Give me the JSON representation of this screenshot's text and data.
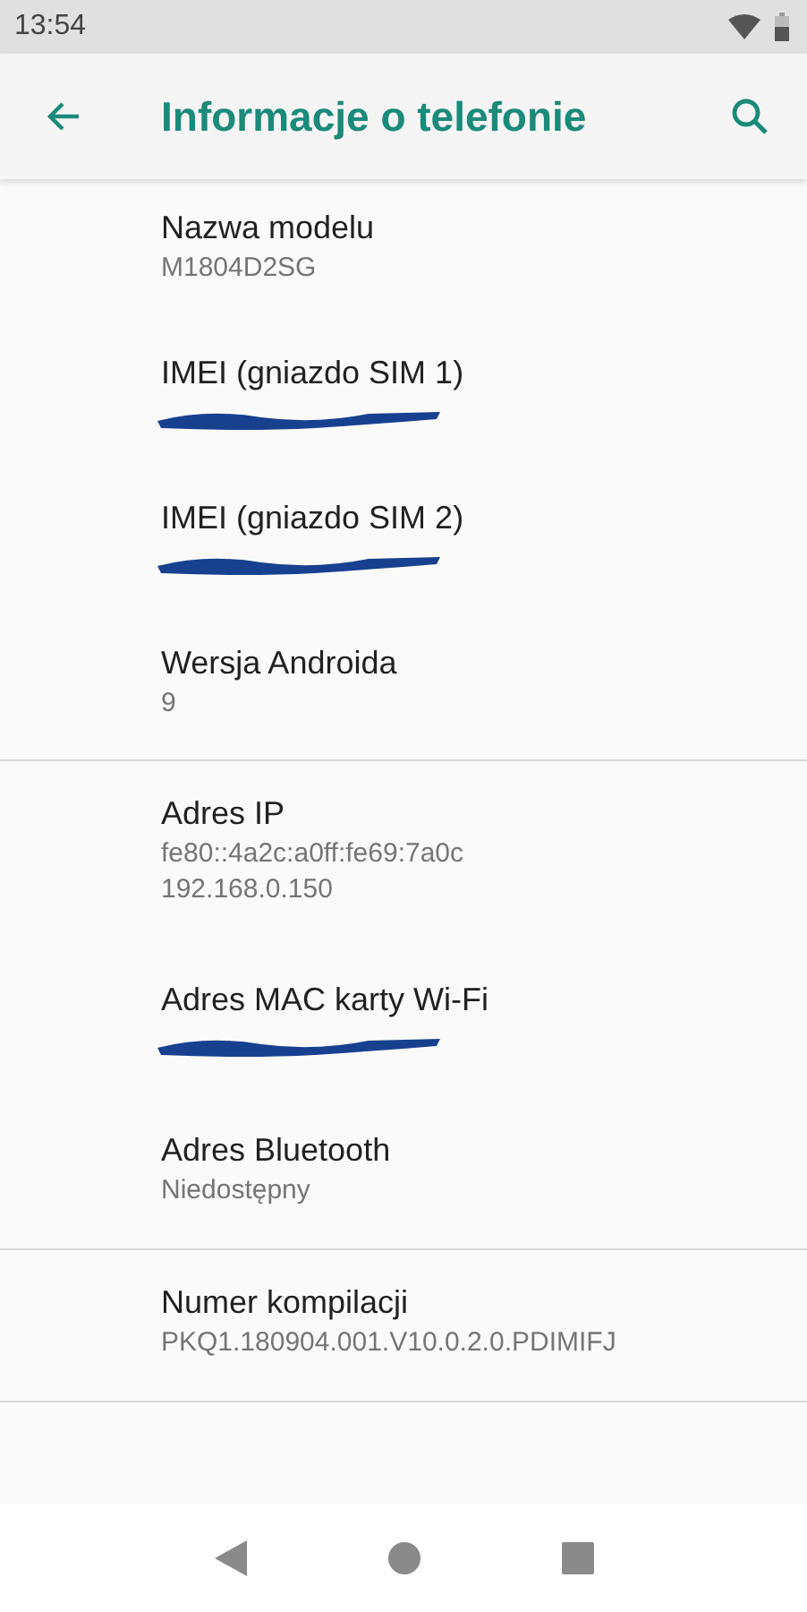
{
  "status_bar": {
    "time": "13:54"
  },
  "toolbar": {
    "title": "Informacje o telefonie"
  },
  "groups": [
    {
      "items": [
        {
          "kind": "text",
          "title": "Nazwa modelu",
          "values": [
            "M1804D2SG"
          ]
        },
        {
          "kind": "redacted",
          "title": "IMEI (gniazdo SIM 1)"
        },
        {
          "kind": "redacted",
          "title": "IMEI (gniazdo SIM 2)"
        },
        {
          "kind": "text",
          "title": "Wersja Androida",
          "values": [
            "9"
          ]
        }
      ]
    },
    {
      "items": [
        {
          "kind": "text",
          "title": "Adres IP",
          "values": [
            "fe80::4a2c:a0ff:fe69:7a0c",
            "192.168.0.150"
          ]
        },
        {
          "kind": "redacted",
          "title": "Adres MAC karty Wi-Fi"
        },
        {
          "kind": "text",
          "title": "Adres Bluetooth",
          "values": [
            "Niedostępny"
          ]
        }
      ]
    },
    {
      "items": [
        {
          "kind": "text",
          "title": "Numer kompilacji",
          "values": [
            "PKQ1.180904.001.V10.0.2.0.PDIMIFJ"
          ]
        }
      ]
    }
  ]
}
